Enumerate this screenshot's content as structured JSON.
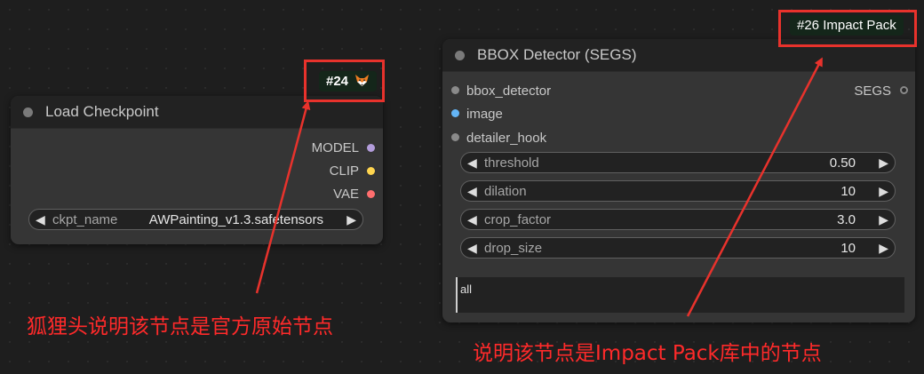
{
  "nodes": {
    "load_checkpoint": {
      "title": "Load Checkpoint",
      "badge": "#24",
      "badge_icon": "fox-head-icon",
      "outputs": [
        {
          "label": "MODEL",
          "color": "#b39ddb"
        },
        {
          "label": "CLIP",
          "color": "#ffd54f"
        },
        {
          "label": "VAE",
          "color": "#ff6e6e"
        }
      ],
      "ckpt_name_label": "ckpt_name",
      "ckpt_name_value": "AWPainting_v1.3.safetensors"
    },
    "bbox_detector": {
      "title": "BBOX Detector (SEGS)",
      "badge": "#26 Impact Pack",
      "inputs": [
        {
          "label": "bbox_detector",
          "color": "#8a8a8a"
        },
        {
          "label": "image",
          "color": "#64b5f6"
        },
        {
          "label": "detailer_hook",
          "color": "#8a8a8a"
        }
      ],
      "output": {
        "label": "SEGS",
        "color": "#8a8a8a"
      },
      "widgets": [
        {
          "label": "threshold",
          "value": "0.50"
        },
        {
          "label": "dilation",
          "value": "10"
        },
        {
          "label": "crop_factor",
          "value": "3.0"
        },
        {
          "label": "drop_size",
          "value": "10"
        }
      ],
      "text_value": "all"
    }
  },
  "annotations": {
    "left": "狐狸头说明该节点是官方原始节点",
    "right": "说明该节点是Impact Pack库中的节点"
  },
  "colors": {
    "annotation_red": "#e8322c"
  }
}
